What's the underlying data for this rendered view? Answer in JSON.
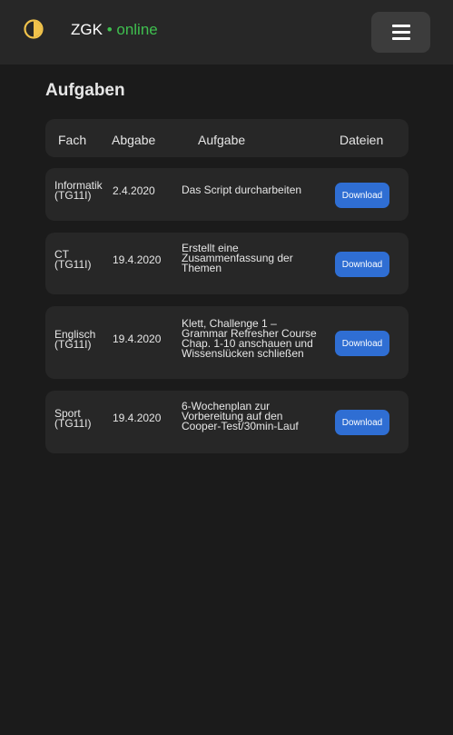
{
  "app": {
    "brand": "ZGK",
    "separator": "•",
    "status": "online",
    "status_color": "#3fbf4f",
    "accent": "#2f6ed3",
    "logo_icon": "half-circle-theme-icon",
    "menu_icon": "hamburger-menu-icon"
  },
  "page": {
    "title": "Aufgaben"
  },
  "table": {
    "headers": [
      "Fach",
      "Abgabe",
      "Aufgabe",
      "Dateien"
    ],
    "rows": [
      {
        "subject": [
          "Informatik",
          "(TG11I)"
        ],
        "due": "2.4.2020",
        "task": [
          "Das Script durcharbeiten"
        ],
        "action": "Download"
      },
      {
        "subject": [
          "CT",
          "(TG11I)"
        ],
        "due": "19.4.2020",
        "task": [
          "Erstellt eine",
          "Zusammenfassung der",
          "Themen"
        ],
        "action": "Download"
      },
      {
        "subject": [
          "Englisch",
          "(TG11I)"
        ],
        "due": "19.4.2020",
        "task": [
          "Klett, Challenge 1 –",
          "Grammar Refresher Course",
          "Chap. 1-10 anschauen und",
          "Wissenslücken schließen"
        ],
        "action": "Download"
      },
      {
        "subject": [
          "Sport",
          "(TG11I)"
        ],
        "due": "19.4.2020",
        "task": [
          "6-Wochenplan zur",
          "Vorbereitung auf den",
          "Cooper-Test/30min-Lauf"
        ],
        "action": "Download"
      }
    ]
  }
}
